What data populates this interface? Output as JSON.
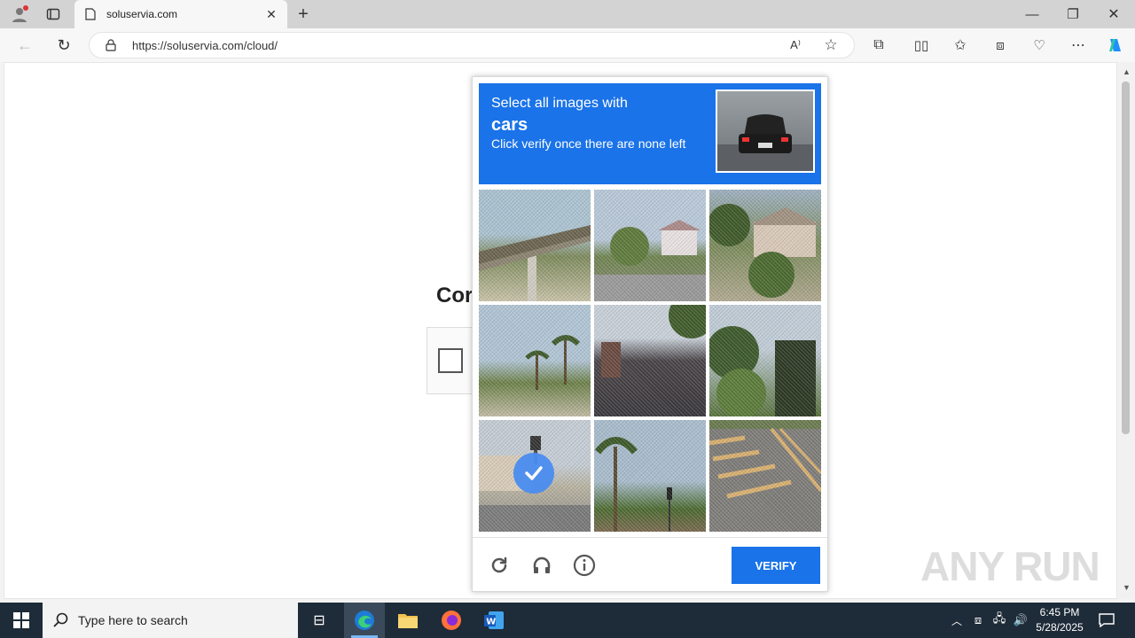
{
  "browser": {
    "tab_title": "soluservia.com",
    "url": "https://soluservia.com/cloud/"
  },
  "page": {
    "heading_fragment": "Cor"
  },
  "captcha": {
    "prompt_line1": "Select all images with",
    "target": "cars",
    "instruction": "Click verify once there are none left",
    "verify_label": "VERIFY",
    "tiles": [
      {
        "scene": "overpass",
        "selected": false
      },
      {
        "scene": "houses-shrubs",
        "selected": false
      },
      {
        "scene": "palm-house",
        "selected": false
      },
      {
        "scene": "palms-hillside",
        "selected": false
      },
      {
        "scene": "rooftop",
        "selected": false
      },
      {
        "scene": "trees-wires",
        "selected": false
      },
      {
        "scene": "street-traffic-light",
        "selected": true
      },
      {
        "scene": "palms-traffic-light",
        "selected": false
      },
      {
        "scene": "road-crosswalk",
        "selected": false
      }
    ],
    "footer_icons": [
      "refresh-icon",
      "headphones-icon",
      "info-icon"
    ]
  },
  "watermark": "ANY RUN",
  "taskbar": {
    "search_placeholder": "Type here to search",
    "time": "6:45 PM",
    "date": "5/28/2025"
  },
  "colors": {
    "accent": "#1a73e8",
    "taskbar": "#1e2b38"
  }
}
